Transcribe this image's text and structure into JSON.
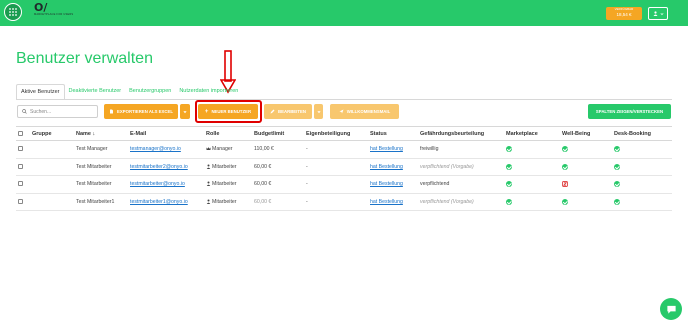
{
  "app": {
    "logo_mark": "O/",
    "logo_subtitle": "MARKETPLACE FOR USERS",
    "budget_label": "VERFÜGBAR",
    "budget_value": "18,54 €",
    "user_icon": "user-icon"
  },
  "page": {
    "title": "Benutzer verwalten"
  },
  "tabs": [
    {
      "label": "Aktive Benutzer",
      "active": true
    },
    {
      "label": "Deaktivierte Benutzer",
      "active": false
    },
    {
      "label": "Benutzergruppen",
      "active": false
    },
    {
      "label": "Nutzerdaten importieren",
      "active": false
    }
  ],
  "toolbar": {
    "search_placeholder": "Suchen...",
    "export_label": "EXPORTIEREN ALS EXCEL",
    "new_user_label": "NEUER BENUTZER",
    "edit_label": "BEARBEITEN",
    "welcome_label": "WILLKOMMENSMAIL",
    "columns_label": "SPALTEN ZEIGEN/VERSTECKEN"
  },
  "table": {
    "headers": {
      "group": "Gruppe",
      "name": "Name ↓",
      "email": "E-Mail",
      "role": "Rolle",
      "budget": "Budgetlimit",
      "copay": "Eigenbeteiligung",
      "status": "Status",
      "risk": "Gefährdungsbeurteilung",
      "marketplace": "Marketplace",
      "wellbeing": "Well-Being",
      "desk": "Desk-Booking"
    },
    "rows": [
      {
        "group": "",
        "name": "Test Manager",
        "email": "testmanager@onyo.io",
        "role": "Manager",
        "budget": "110,00 €",
        "copay": "-",
        "status": "hat Bestellung",
        "risk": "freiwillig"
      },
      {
        "group": "",
        "name": "Test Mitarbeiter",
        "email": "testmitarbeiter2@onyo.io",
        "role": "Mitarbeiter",
        "budget": "60,00 €",
        "copay": "-",
        "status": "hat Bestellung",
        "risk": "verpflichtend (Vorgabe)"
      },
      {
        "group": "",
        "name": "Test Mitarbeiter",
        "email": "testmitarbeiter@onyo.io",
        "role": "Mitarbeiter",
        "budget": "60,00 €",
        "copay": "-",
        "status": "hat Bestellung",
        "risk": "verpflichtend"
      },
      {
        "group": "",
        "name": "Test Mitarbeiter1",
        "email": "testmitarbeiter1@onyo.io",
        "role": "Mitarbeiter",
        "budget": "60,00 €",
        "copay": "-",
        "status": "hat Bestellung",
        "risk": "verpflichtend (Vorgabe)"
      }
    ]
  },
  "colors": {
    "accent": "#27c96a",
    "orange": "#f5a623",
    "highlight": "#e00000",
    "link": "#1a73c9"
  }
}
